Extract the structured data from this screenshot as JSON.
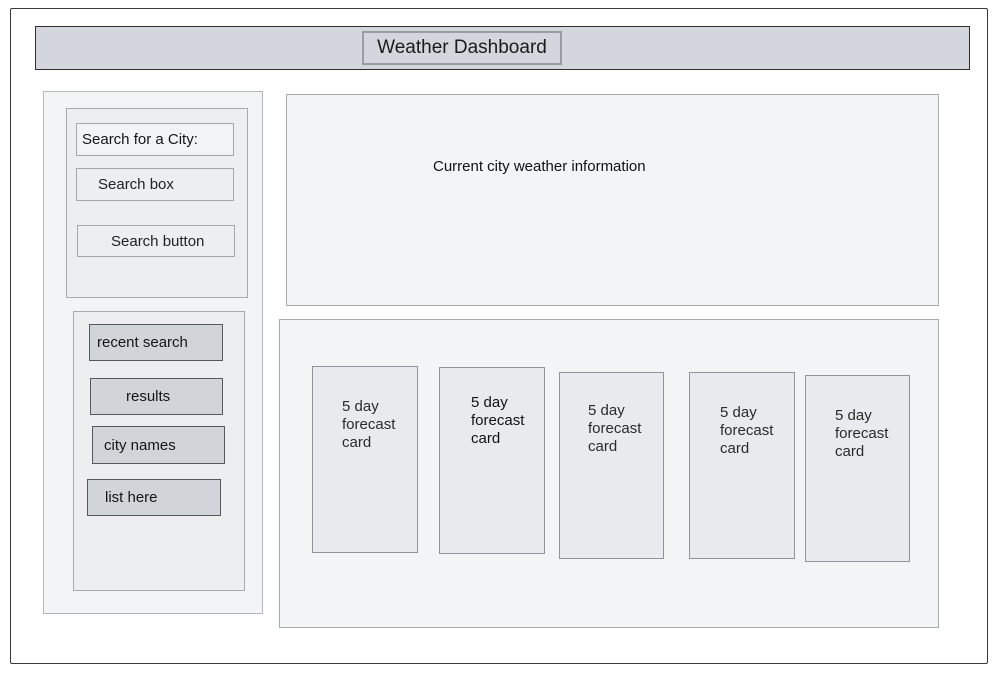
{
  "header": {
    "title": "Weather Dashboard"
  },
  "search": {
    "label": "Search for a City:",
    "box_text": "Search box",
    "button_label": "Search button"
  },
  "history": {
    "items": [
      {
        "label": "recent search"
      },
      {
        "label": "results"
      },
      {
        "label": "city names"
      },
      {
        "label": "list here"
      }
    ]
  },
  "current": {
    "text": "Current city weather information"
  },
  "forecast": {
    "cards": [
      {
        "label": "5 day\nforecast\ncard"
      },
      {
        "label": "5 day\nforecast\ncard"
      },
      {
        "label": "5 day\nforecast\ncard"
      },
      {
        "label": "5 day\nforecast\ncard"
      },
      {
        "label": "5 day\nforecast\ncard"
      }
    ]
  },
  "colors": {
    "header_bg": "#d3d6dc",
    "panel_bg": "#f3f4f5",
    "history_item_bg": "#d1d4d8",
    "card_bg": "#e8eaed"
  }
}
